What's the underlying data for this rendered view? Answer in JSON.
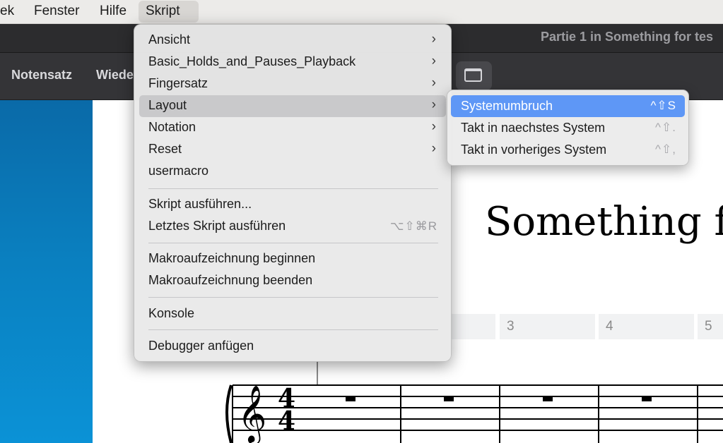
{
  "menubar": {
    "items": [
      {
        "label": "ek"
      },
      {
        "label": "Fenster"
      },
      {
        "label": "Hilfe"
      },
      {
        "label": "Skript"
      }
    ]
  },
  "window": {
    "title": "Partie 1 in Something for tes"
  },
  "toolbar": {
    "tabs": [
      {
        "label": "Notensatz"
      },
      {
        "label": "Wiede"
      }
    ],
    "layout_button_icon": "window-icon"
  },
  "score": {
    "title": "Something fo",
    "measure_numbers": [
      "3",
      "4",
      "5"
    ],
    "time_signature": {
      "top": "4",
      "bottom": "4"
    }
  },
  "skript_menu": {
    "items": [
      {
        "label": "Ansicht",
        "submenu": true
      },
      {
        "label": "Basic_Holds_and_Pauses_Playback",
        "submenu": true
      },
      {
        "label": "Fingersatz",
        "submenu": true
      },
      {
        "label": "Layout",
        "submenu": true
      },
      {
        "label": "Notation",
        "submenu": true
      },
      {
        "label": "Reset",
        "submenu": true
      },
      {
        "label": "usermacro",
        "submenu": false
      },
      {
        "label": "Skript ausführen...",
        "submenu": false
      },
      {
        "label": "Letztes Skript ausführen",
        "submenu": false,
        "shortcut": "⌥⇧⌘R"
      },
      {
        "label": "Makroaufzeichnung beginnen",
        "submenu": false
      },
      {
        "label": "Makroaufzeichnung beenden",
        "submenu": false
      },
      {
        "label": "Konsole",
        "submenu": false
      },
      {
        "label": "Debugger anfügen",
        "submenu": false
      }
    ],
    "chevron": "›"
  },
  "layout_submenu": {
    "items": [
      {
        "label": "Systemumbruch",
        "shortcut": "^⇧S",
        "selected": true
      },
      {
        "label": "Takt in naechstes System",
        "shortcut": "^⇧."
      },
      {
        "label": "Takt in vorheriges System",
        "shortcut": "^⇧,"
      }
    ]
  },
  "colors": {
    "selection": "#5e97f6",
    "left_panel": "#0a7fbf"
  }
}
